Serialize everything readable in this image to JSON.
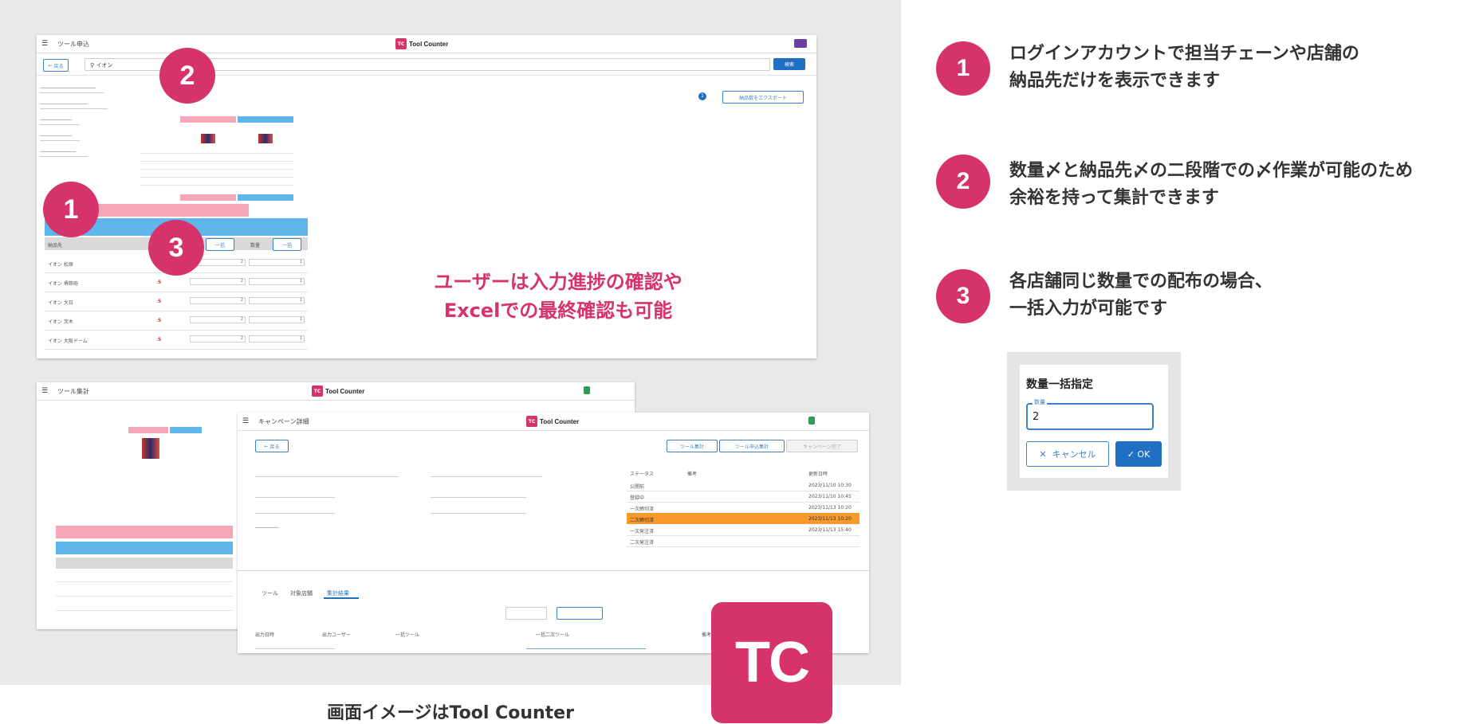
{
  "colors": {
    "accent": "#d6336c",
    "primary_blue": "#1f6fc2",
    "pink_cell": "#f5a7b8",
    "blue_cell": "#5fb6ea",
    "orange_row": "#f79a2b"
  },
  "screen1": {
    "window_title": "ツール申込",
    "brand": "Tool Counter",
    "brand_icon": "TC",
    "back_label": "戻る",
    "search_value": "イオン",
    "search_button": "検索",
    "export_button": "納品数をエクスポート",
    "page_number": "1",
    "rows": [
      {
        "store": "イオン 松原",
        "mark": "",
        "qty1": "2",
        "qty2": "1"
      },
      {
        "store": "イオン 堺鉄砲",
        "mark": "5",
        "qty1": "2",
        "qty2": "1"
      },
      {
        "store": "イオン 大日",
        "mark": "5",
        "qty1": "2",
        "qty2": "1"
      },
      {
        "store": "イオン 茨木",
        "mark": "5",
        "qty1": "2",
        "qty2": "1"
      },
      {
        "store": "イオン 大阪ドーム",
        "mark": "5",
        "qty1": "2",
        "qty2": "1"
      }
    ],
    "batch_button": "一括",
    "header_store": "納品先",
    "header_qty": "数量"
  },
  "screen2": {
    "window_title": "ツール集計",
    "brand": "Tool Counter",
    "brand_icon": "TC"
  },
  "screen3": {
    "window_title": "キャンペーン詳細",
    "brand": "Tool Counter",
    "brand_icon": "TC",
    "back_label": "戻る",
    "action_buttons": [
      "ツール集計",
      "ツール申込集計",
      "キャンペーン完了"
    ],
    "status_header": [
      "ステータス",
      "備考",
      "更新日時"
    ],
    "status_rows": [
      {
        "status": "公開前",
        "note": "",
        "date": "2023/11/10 10:30"
      },
      {
        "status": "登録中",
        "note": "",
        "date": "2023/11/10 10:45"
      },
      {
        "status": "一次締切済",
        "note": "",
        "date": "2023/11/13 10:20"
      },
      {
        "status": "二次締切済",
        "note": "",
        "date": "2023/11/13 10:20"
      },
      {
        "status": "一次発注済",
        "note": "",
        "date": "2023/11/13 15:40"
      },
      {
        "status": "二次発注済",
        "note": "",
        "date": ""
      }
    ],
    "tabs": [
      "ツール",
      "対象店舗",
      "集計結果"
    ],
    "list_headers": [
      "出力日時",
      "出力ユーザー",
      "一括ツール",
      "一括二次ツール",
      "備考"
    ]
  },
  "callouts": {
    "one": "1",
    "two": "2",
    "three": "3",
    "pink_caption_line1": "ユーザーは入力進捗の確認や",
    "pink_caption_line2": "Excelでの最終確認も可能",
    "bottom_caption": "画面イメージはTool Counter",
    "logo_text": "TC"
  },
  "features": [
    {
      "number": "1",
      "line1": "ログインアカウントで担当チェーンや店舗の",
      "line2": "納品先だけを表示できます"
    },
    {
      "number": "2",
      "line1": "数量〆と納品先〆の二段階での〆作業が可能のため",
      "line2": "余裕を持って集計できます"
    },
    {
      "number": "3",
      "line1": "各店舗同じ数量での配布の場合、",
      "line2": "一括入力が可能です"
    }
  ],
  "dialog": {
    "title": "数量一括指定",
    "input_label": "数量",
    "input_value": "2",
    "cancel": "キャンセル",
    "ok": "OK"
  }
}
